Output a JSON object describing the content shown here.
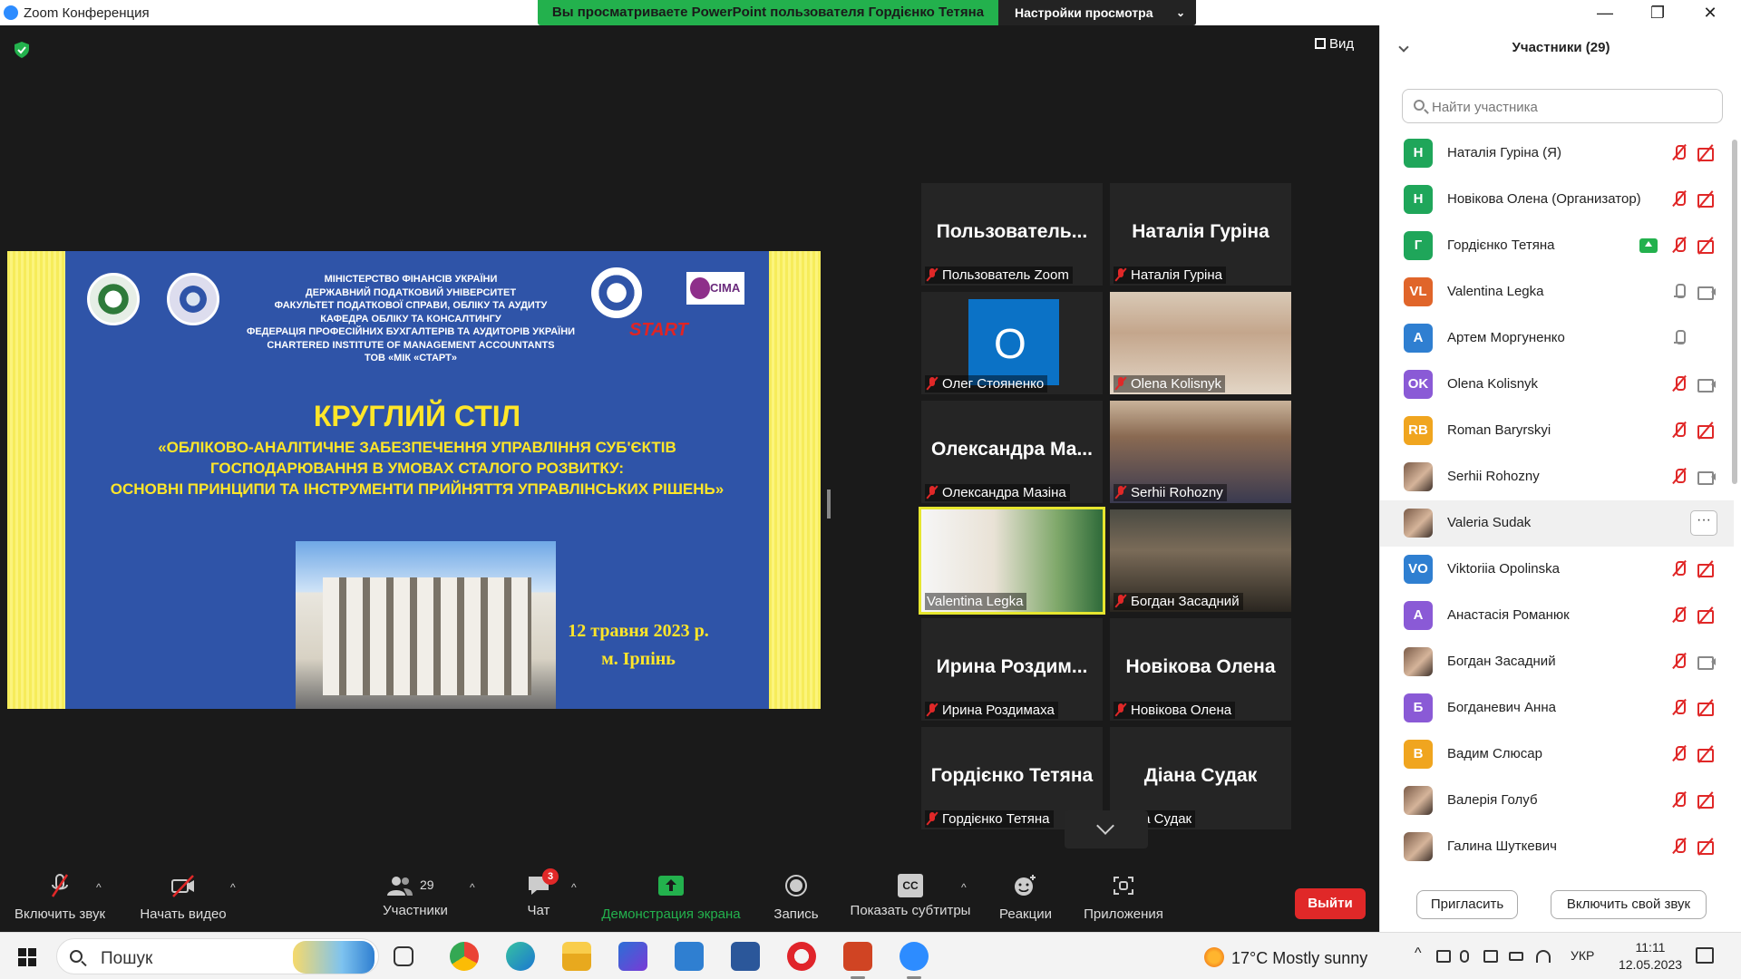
{
  "window": {
    "app_title": "Zoom Конференция",
    "share_banner": "Вы просматриваете PowerPoint пользователя Гордієнко Тетяна",
    "view_settings_label": "Настройки просмотра",
    "view_label": "Вид"
  },
  "slide": {
    "org_lines": [
      "МІНІСТЕРСТВО ФІНАНСІВ УКРАЇНИ",
      "ДЕРЖАВНИЙ ПОДАТКОВИЙ УНІВЕРСИТЕТ",
      "ФАКУЛЬТЕТ ПОДАТКОВОЇ СПРАВИ, ОБЛІКУ ТА АУДИТУ",
      "КАФЕДРА ОБЛІКУ ТА КОНСАЛТИНГУ",
      "ФЕДЕРАЦІЯ ПРОФЕСІЙНИХ БУХГАЛТЕРІВ ТА АУДИТОРІВ УКРАЇНИ",
      "CHARTERED INSTITUTE OF MANAGEMENT ACCOUNTANTS",
      "ТОВ «МІК «СТАРТ»"
    ],
    "logo_cima": "CIMA",
    "logo_start": "START",
    "title": "КРУГЛИЙ СТІЛ",
    "subtitle_lines": [
      "«ОБЛІКОВО-АНАЛІТИЧНЕ ЗАБЕЗПЕЧЕННЯ УПРАВЛІННЯ СУБ'ЄКТІВ",
      "ГОСПОДАРЮВАННЯ В УМОВАХ СТАЛОГО РОЗВИТКУ:",
      "ОСНОВНІ ПРИНЦИПИ ТА ІНСТРУМЕНТИ ПРИЙНЯТТЯ УПРАВЛІНСЬКИХ РІШЕНЬ»"
    ],
    "date": "12 травня 2023 р.",
    "city": "м. Ірпінь"
  },
  "tiles": [
    {
      "big_name": "Пользователь...",
      "label": "Пользователь Zoom",
      "muted": true,
      "kind": "name"
    },
    {
      "big_name": "Наталія Гуріна",
      "label": "Наталія Гуріна",
      "muted": true,
      "kind": "name"
    },
    {
      "big_name": "",
      "label": "Олег Стояненко",
      "muted": true,
      "kind": "outlook"
    },
    {
      "big_name": "",
      "label": "Olena Kolisnyk",
      "muted": true,
      "kind": "photo"
    },
    {
      "big_name": "Олександра Ма...",
      "label": "Олександра Мазіна",
      "muted": true,
      "kind": "name"
    },
    {
      "big_name": "",
      "label": "Serhii Rohozny",
      "muted": true,
      "kind": "photo"
    },
    {
      "big_name": "",
      "label": "Valentina Legka",
      "muted": false,
      "kind": "photo",
      "active": true
    },
    {
      "big_name": "",
      "label": "Богдан Засадний",
      "muted": true,
      "kind": "photo"
    },
    {
      "big_name": "Ирина Роздим...",
      "label": "Ирина Роздимаха",
      "muted": true,
      "kind": "name"
    },
    {
      "big_name": "Новікова Олена",
      "label": "Новікова Олена",
      "muted": true,
      "kind": "name"
    },
    {
      "big_name": "Гордієнко Тетяна",
      "label": "Гордієнко Тетяна",
      "muted": true,
      "kind": "name"
    },
    {
      "big_name": "Діана Судак",
      "label": "Діана Судак",
      "muted": false,
      "kind": "name"
    }
  ],
  "toolbar": {
    "unmute": "Включить звук",
    "start_video": "Начать видео",
    "participants": "Участники",
    "participants_count": "29",
    "chat": "Чат",
    "chat_badge": "3",
    "share": "Демонстрация экрана",
    "record": "Запись",
    "captions": "Показать субтитры",
    "captions_icon_text": "CC",
    "reactions": "Реакции",
    "apps": "Приложения",
    "leave": "Выйти"
  },
  "panel": {
    "title": "Участники (29)",
    "search_placeholder": "Найти участника",
    "invite": "Пригласить",
    "unmute_me": "Включить свой звук",
    "participants": [
      {
        "initials": "Н",
        "name": "Наталія Гуріна (Я)",
        "color": "#1fa65a",
        "mic": "off",
        "cam": "off"
      },
      {
        "initials": "Н",
        "name": "Новікова Олена (Организатор)",
        "color": "#1fa65a",
        "mic": "off",
        "cam": "off"
      },
      {
        "initials": "Г",
        "name": "Гордієнко Тетяна",
        "color": "#1fa65a",
        "mic": "off",
        "cam": "off",
        "sharing": true
      },
      {
        "initials": "VL",
        "name": "Valentina Legka",
        "color": "#e0652a",
        "mic": "on",
        "cam": "on"
      },
      {
        "initials": "А",
        "name": "Артем Моргуненко",
        "color": "#2f7fd1",
        "mic": "on",
        "cam": "none"
      },
      {
        "initials": "OK",
        "name": "Olena Kolisnyk",
        "color": "#8a5ad6",
        "mic": "off",
        "cam": "on"
      },
      {
        "initials": "RB",
        "name": "Roman Baryrskyi",
        "color": "#f0a51f",
        "mic": "off",
        "cam": "off"
      },
      {
        "initials": "",
        "name": "Serhii Rohozny",
        "color": "",
        "mic": "off",
        "cam": "on",
        "photo": true
      },
      {
        "initials": "",
        "name": "Valeria Sudak",
        "color": "",
        "mic": "none",
        "cam": "none",
        "photo": true,
        "hover": true
      },
      {
        "initials": "VO",
        "name": "Viktoriia Opolinska",
        "color": "#2f7fd1",
        "mic": "off",
        "cam": "off"
      },
      {
        "initials": "А",
        "name": "Анастасія Романюк",
        "color": "#8a5ad6",
        "mic": "off",
        "cam": "off"
      },
      {
        "initials": "",
        "name": "Богдан Засадний",
        "color": "",
        "mic": "off",
        "cam": "on",
        "photo": true
      },
      {
        "initials": "Б",
        "name": "Богданевич Анна",
        "color": "#8a5ad6",
        "mic": "off",
        "cam": "off"
      },
      {
        "initials": "В",
        "name": "Вадим Слюсар",
        "color": "#f0a51f",
        "mic": "off",
        "cam": "off"
      },
      {
        "initials": "",
        "name": "Валерія Голуб",
        "color": "",
        "mic": "off",
        "cam": "off",
        "photo": true
      },
      {
        "initials": "",
        "name": "Галина Шуткевич",
        "color": "",
        "mic": "off",
        "cam": "off",
        "photo": true
      }
    ]
  },
  "taskbar": {
    "search_text": "Пошук",
    "weather": "17°C  Mostly sunny",
    "lang": "УКР",
    "time": "11:11",
    "date": "12.05.2023"
  }
}
